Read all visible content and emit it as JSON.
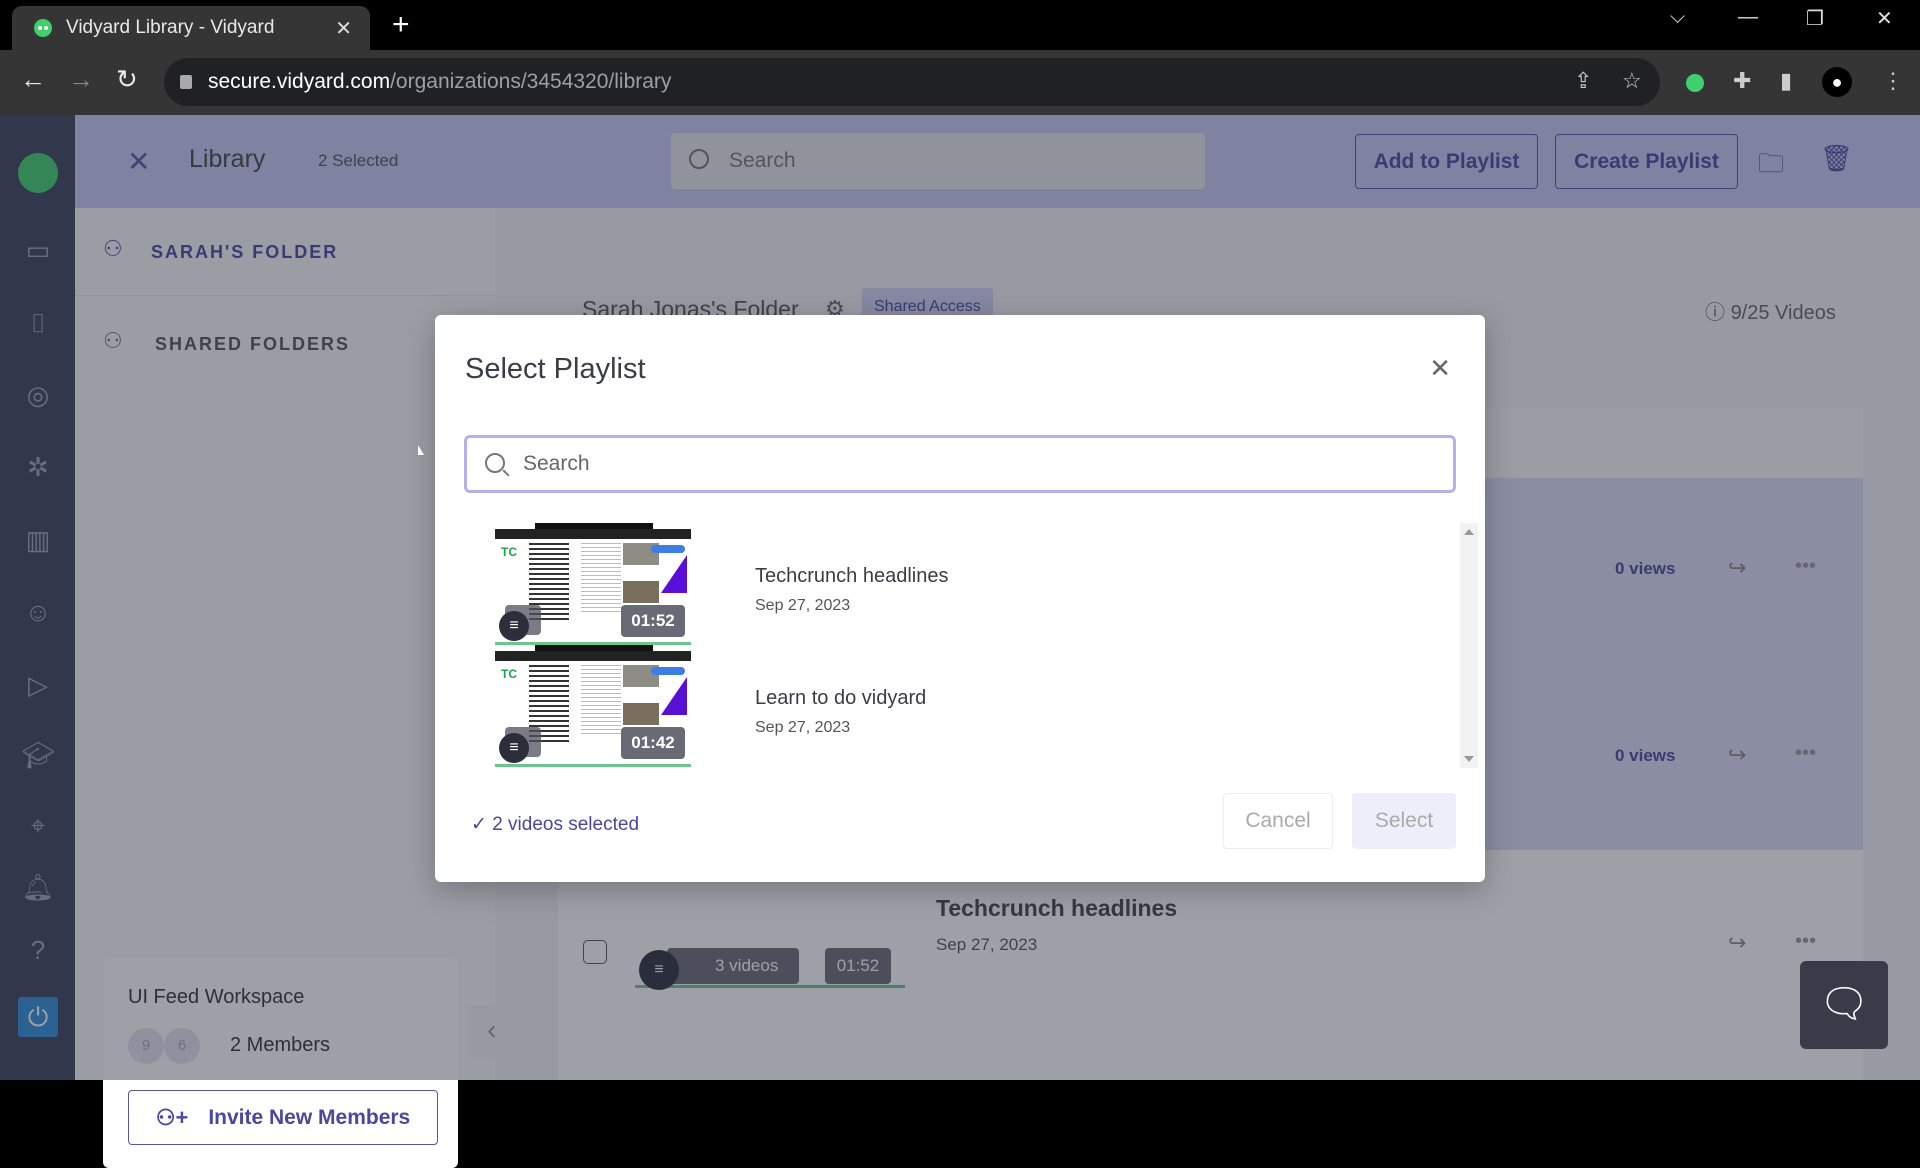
{
  "browser": {
    "tab_title": "Vidyard Library - Vidyard",
    "url_host": "secure.vidyard.com",
    "url_path": "/organizations/3454320/library"
  },
  "header": {
    "title": "Library",
    "selected_count": "2 Selected",
    "search_placeholder": "Search",
    "add_to_playlist": "Add to Playlist",
    "create_playlist": "Create Playlist"
  },
  "sidebar": {
    "my_folder": "SARAH'S FOLDER",
    "shared_folders": "SHARED FOLDERS",
    "workspace_name": "UI Feed Workspace",
    "member_avatars": [
      "9",
      "6"
    ],
    "members": "2 Members",
    "invite_button": "Invite New Members"
  },
  "folder": {
    "name": "Sarah Jonas's Folder",
    "access_badge": "Shared Access",
    "video_count": "9/25 Videos"
  },
  "library_rows": [
    {
      "views": "0 views"
    },
    {
      "views": "0 views"
    },
    {
      "name": "Techcrunch headlines",
      "date": "Sep 27, 2023",
      "videos": "3 videos",
      "duration": "01:52"
    }
  ],
  "modal": {
    "title": "Select Playlist",
    "search_placeholder": "Search",
    "playlists": [
      {
        "name": "Techcrunch headlines",
        "date": "Sep 27, 2023",
        "duration": "01:52"
      },
      {
        "name": "Learn to do vidyard",
        "date": "Sep 27, 2023",
        "duration": "01:42"
      }
    ],
    "selected_status": "✓ 2 videos selected",
    "cancel": "Cancel",
    "select": "Select"
  }
}
